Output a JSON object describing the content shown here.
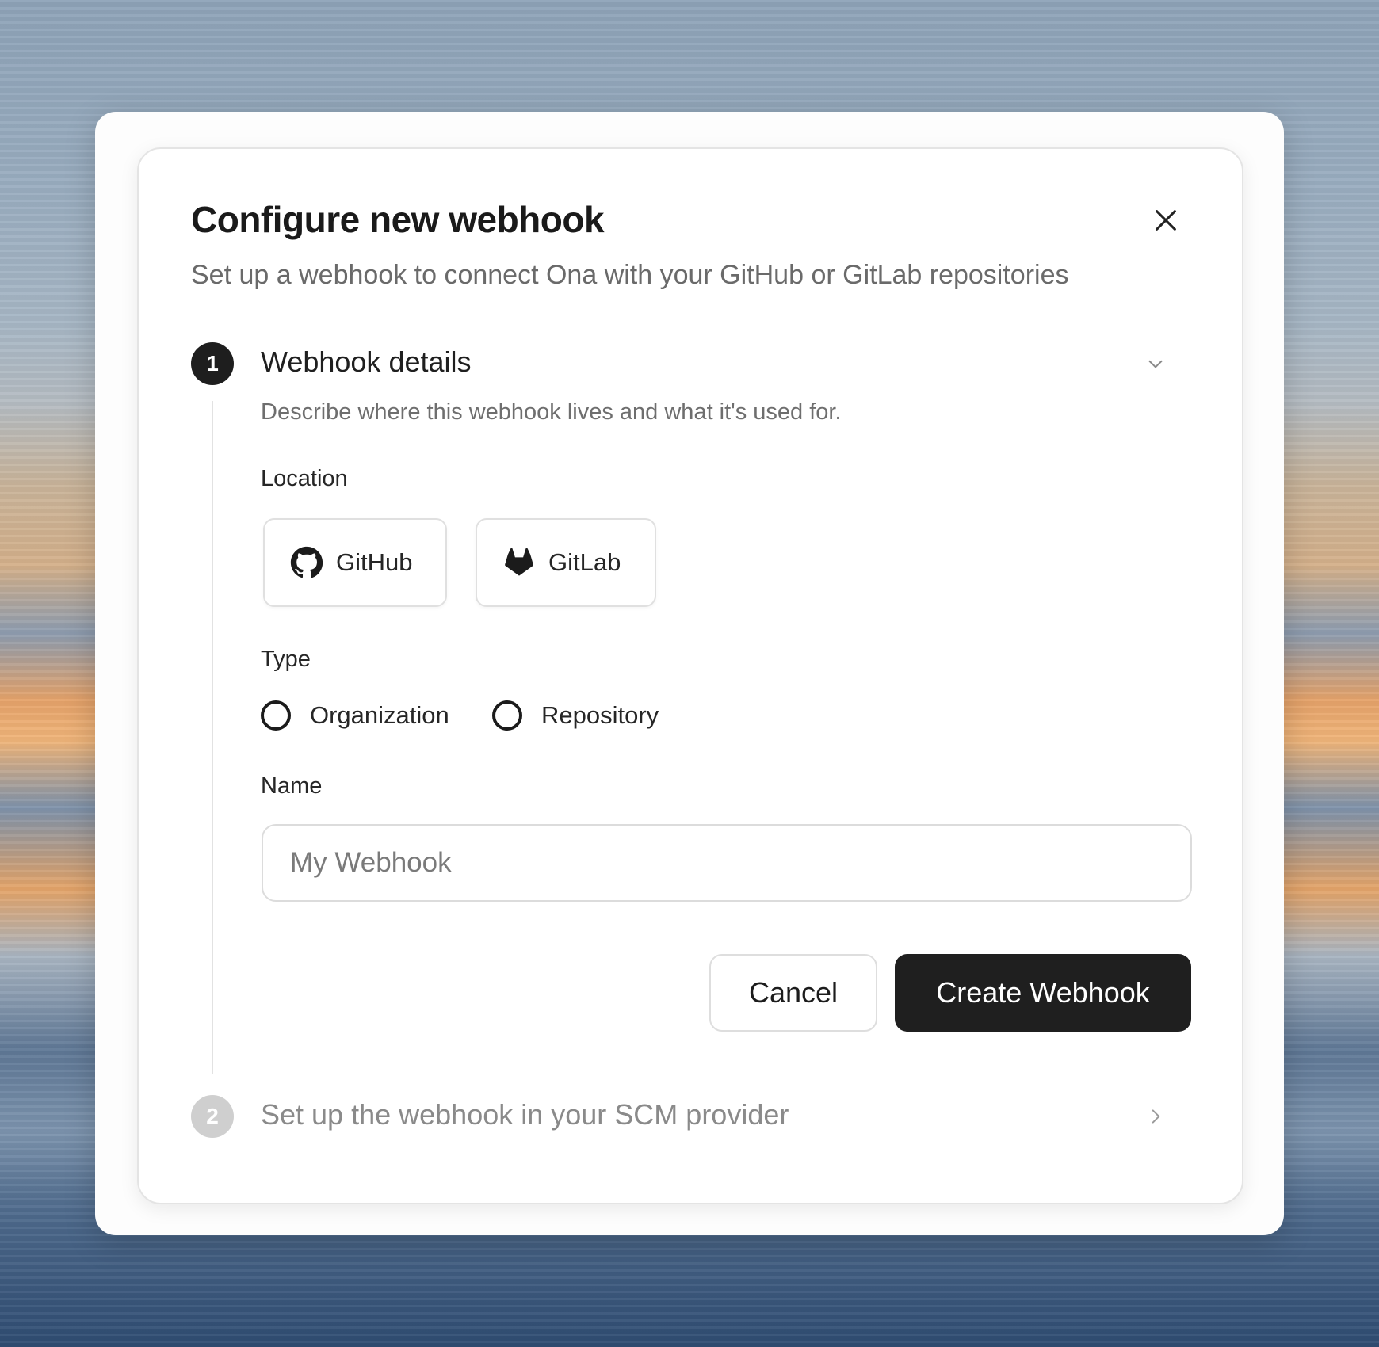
{
  "dialog": {
    "title": "Configure new webhook",
    "subtitle": "Set up a webhook to connect Ona with your GitHub or GitLab repositories",
    "close_icon": "close-icon"
  },
  "step1": {
    "number": "1",
    "title": "Webhook details",
    "description": "Describe where this webhook lives and what it's used for.",
    "expanded": true,
    "location": {
      "label": "Location",
      "options": [
        {
          "label": "GitHub",
          "icon": "github-icon"
        },
        {
          "label": "GitLab",
          "icon": "gitlab-icon"
        }
      ]
    },
    "type": {
      "label": "Type",
      "options": [
        {
          "label": "Organization",
          "selected": false
        },
        {
          "label": "Repository",
          "selected": false
        }
      ]
    },
    "name": {
      "label": "Name",
      "value": "",
      "placeholder": "My Webhook"
    },
    "actions": {
      "cancel_label": "Cancel",
      "create_label": "Create Webhook"
    }
  },
  "step2": {
    "number": "2",
    "title": "Set up the webhook in your SCM provider",
    "expanded": false
  },
  "colors": {
    "primary_button": "#1f1f1f",
    "active_step": "#1e1e1e",
    "inactive_step": "#cfcfcf"
  }
}
